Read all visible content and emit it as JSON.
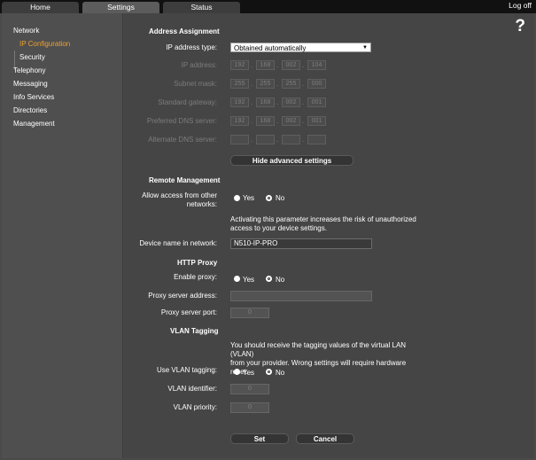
{
  "tabs": {
    "home": "Home",
    "settings": "Settings",
    "status": "Status"
  },
  "logoff": "Log off",
  "help": "?",
  "sidebar": {
    "network": "Network",
    "ip_configuration": "IP Configuration",
    "security": "Security",
    "telephony": "Telephony",
    "messaging": "Messaging",
    "info_services": "Info Services",
    "directories": "Directories",
    "management": "Management"
  },
  "address_assignment": {
    "title": "Address Assignment",
    "ip_type_label": "IP address type:",
    "ip_type_value": "Obtained automatically",
    "ip_address_label": "IP address:",
    "ip_address": [
      "192",
      "168",
      "002",
      "104"
    ],
    "subnet_label": "Subnet mask:",
    "subnet": [
      "255",
      "255",
      "255",
      "000"
    ],
    "gateway_label": "Standard gateway:",
    "gateway": [
      "192",
      "168",
      "002",
      "001"
    ],
    "pref_dns_label": "Preferred DNS server:",
    "pref_dns": [
      "192",
      "168",
      "002",
      "001"
    ],
    "alt_dns_label": "Alternate DNS server:",
    "alt_dns": [
      "",
      "",
      "",
      ""
    ],
    "hide_advanced": "Hide advanced settings"
  },
  "remote_management": {
    "title": "Remote Management",
    "allow_label_1": "Allow access from other",
    "allow_label_2": "networks:",
    "yes": "Yes",
    "no": "No",
    "selected": "No",
    "note_1": "Activating this parameter increases the risk of unauthorized",
    "note_2": "access to your device settings.",
    "device_name_label": "Device name in network:",
    "device_name": "N510-IP-PRO"
  },
  "http_proxy": {
    "title": "HTTP Proxy",
    "enable_label": "Enable proxy:",
    "yes": "Yes",
    "no": "No",
    "selected": "No",
    "server_address_label": "Proxy server address:",
    "server_address": "",
    "server_port_label": "Proxy server port:",
    "server_port": "0"
  },
  "vlan": {
    "title": "VLAN Tagging",
    "note_1": "You should receive the tagging values of the virtual LAN (VLAN)",
    "note_2": "from your provider. Wrong settings will require hardware reset.",
    "use_label": "Use VLAN tagging:",
    "yes": "Yes",
    "no": "No",
    "selected": "No",
    "identifier_label": "VLAN identifier:",
    "identifier": "0",
    "priority_label": "VLAN priority:",
    "priority": "0"
  },
  "actions": {
    "set": "Set",
    "cancel": "Cancel"
  },
  "colors": {
    "active_nav": "#f0a030",
    "background": "#454545",
    "topbar": "#111111"
  }
}
